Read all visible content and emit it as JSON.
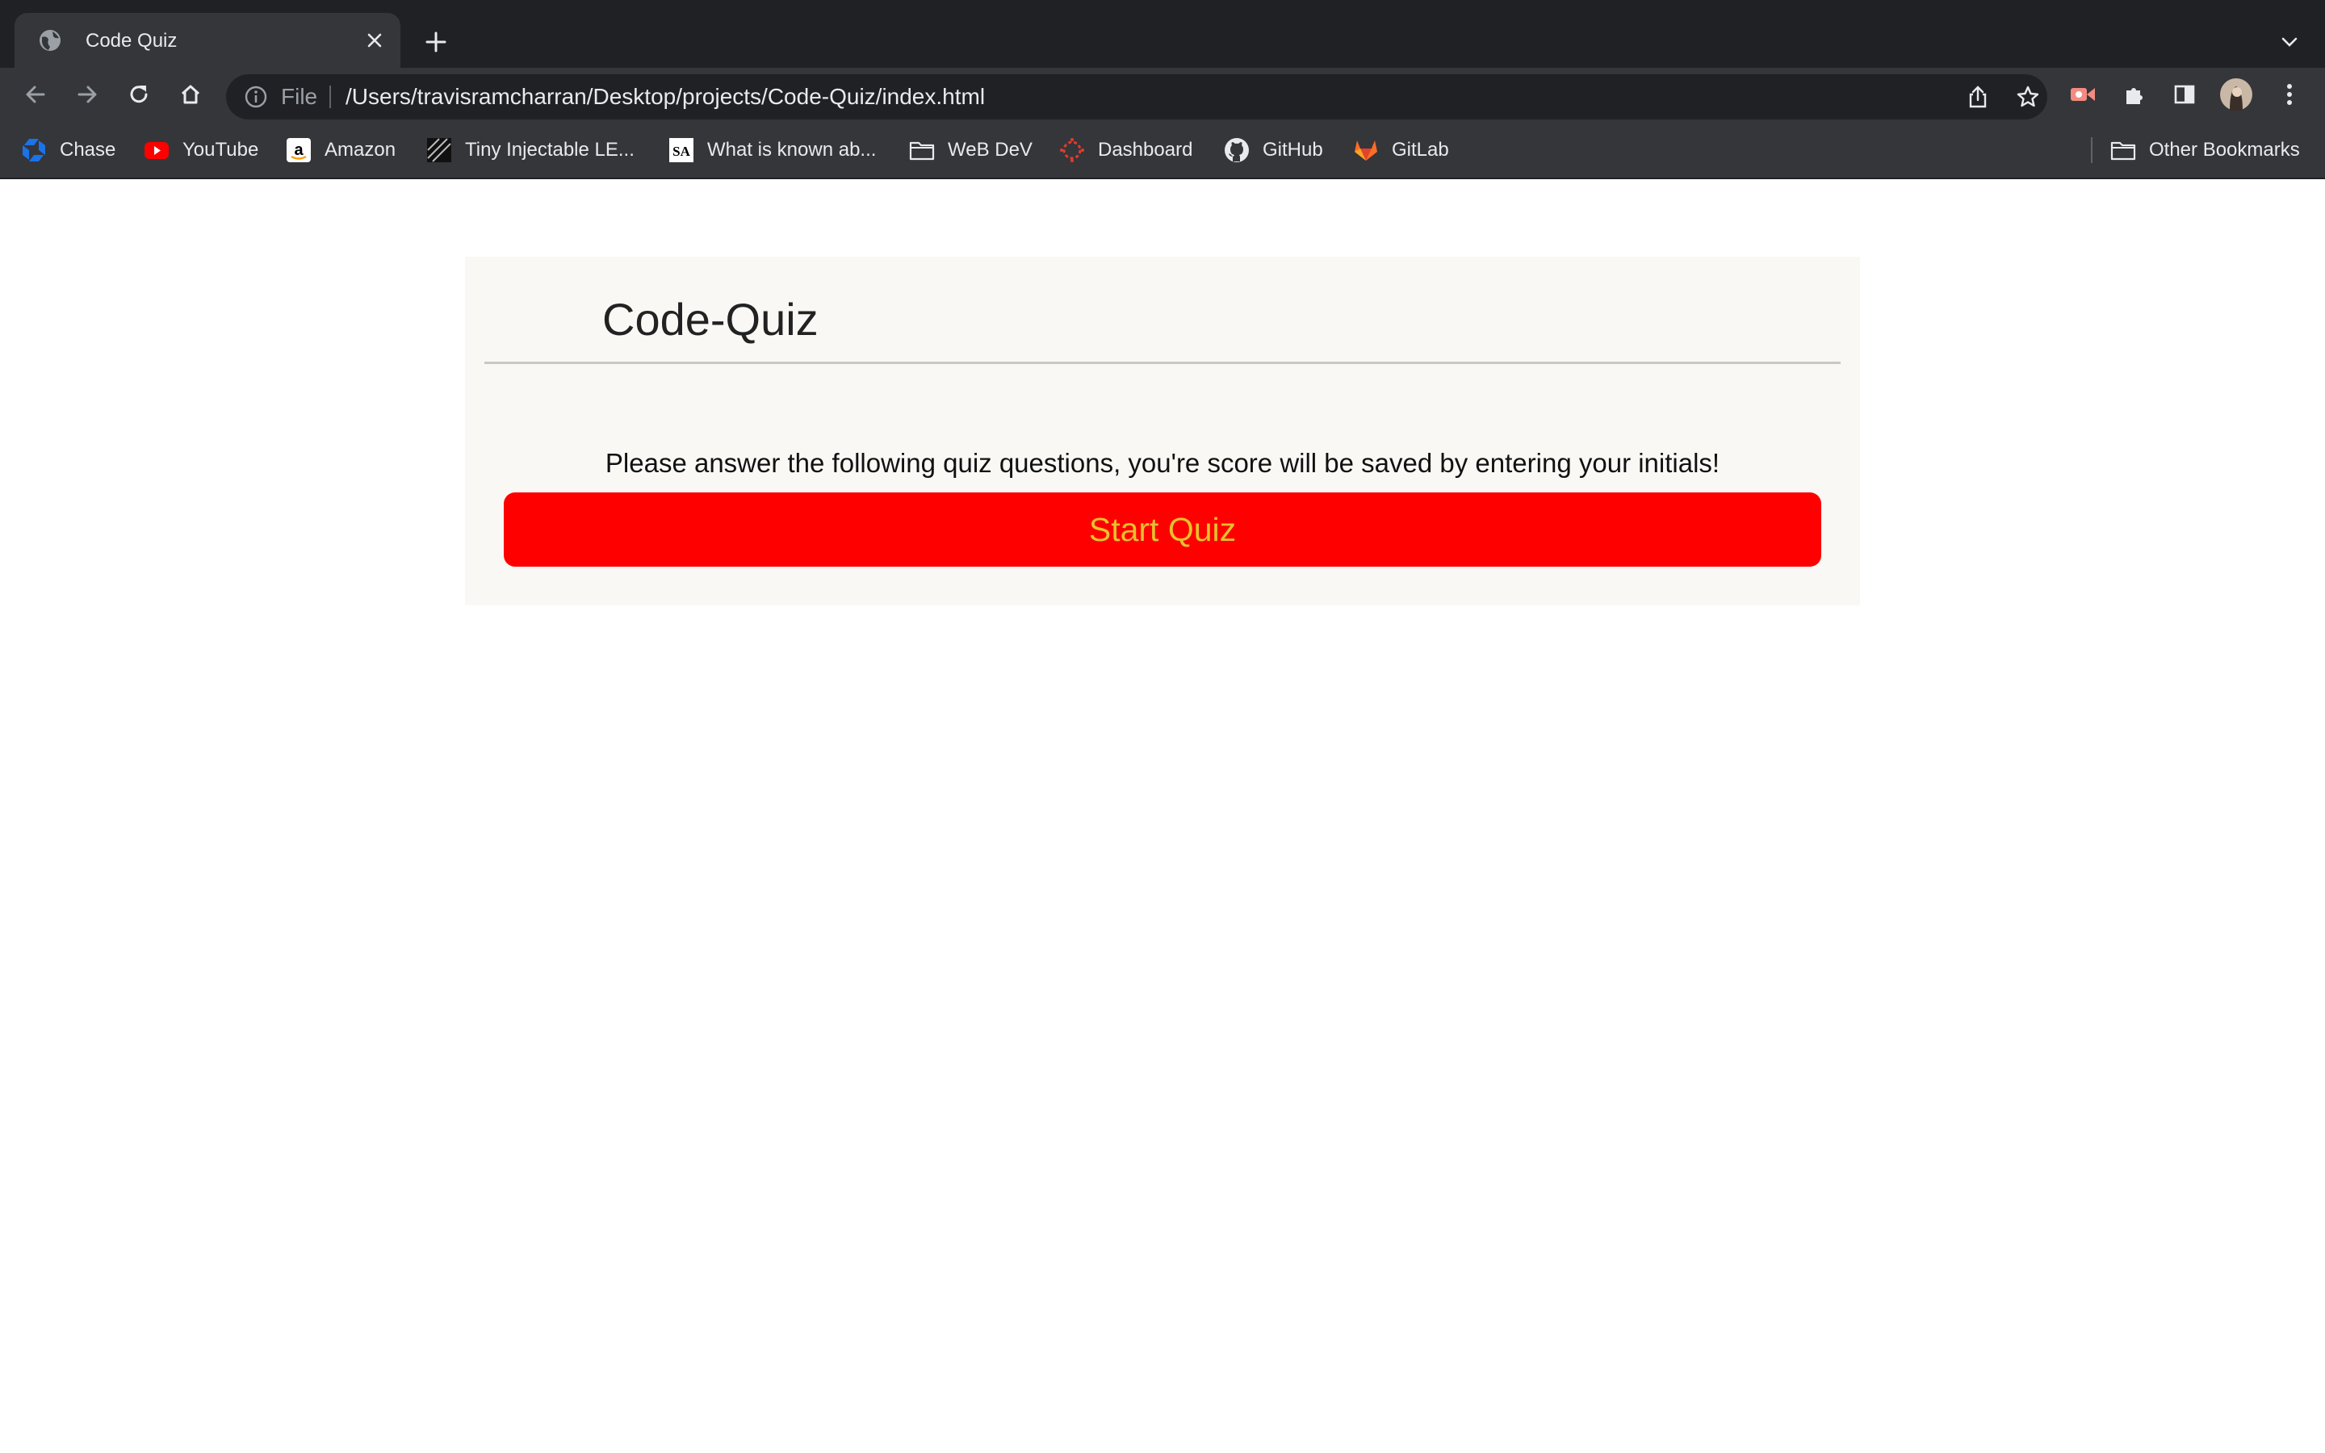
{
  "browser": {
    "tab": {
      "title": "Code Quiz",
      "favicon": "globe-icon"
    },
    "address_bar": {
      "scheme_label": "File",
      "url": "/Users/travisramcharran/Desktop/projects/Code-Quiz/index.html"
    },
    "bookmarks": [
      {
        "label": "Chase",
        "icon": "chase-icon"
      },
      {
        "label": "YouTube",
        "icon": "youtube-icon"
      },
      {
        "label": "Amazon",
        "icon": "amazon-icon"
      },
      {
        "label": "Tiny Injectable LE...",
        "icon": "page-thumbnail-icon"
      },
      {
        "label": "What is known ab...",
        "icon": "sa-logo-icon"
      },
      {
        "label": "WeB DeV",
        "icon": "folder-icon"
      },
      {
        "label": "Dashboard",
        "icon": "canvas-icon"
      },
      {
        "label": "GitHub",
        "icon": "github-icon"
      },
      {
        "label": "GitLab",
        "icon": "gitlab-icon"
      }
    ],
    "other_bookmarks": {
      "label": "Other Bookmarks",
      "icon": "folder-icon"
    }
  },
  "page": {
    "title": "Code-Quiz",
    "intro": "Please answer the following quiz questions, you're score will be saved by entering your initials!",
    "start_button": "Start Quiz"
  },
  "colors": {
    "start_button_bg": "#ff0000",
    "start_button_text": "#e6c02e",
    "card_bg": "#f9f8f5",
    "chrome_dark": "#202124",
    "chrome_toolbar": "#35363a"
  }
}
